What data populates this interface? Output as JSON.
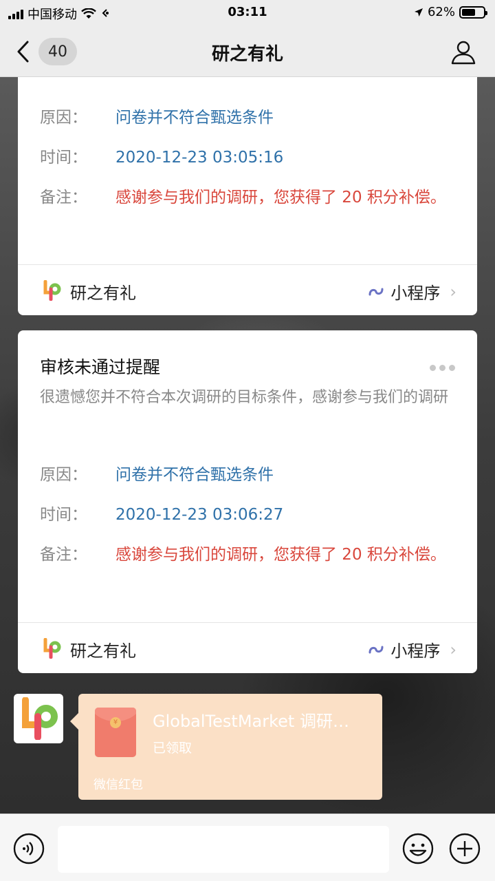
{
  "status_bar": {
    "carrier": "中国移动",
    "time": "03:11",
    "battery": "62%",
    "battery_level": 0.62
  },
  "nav": {
    "unread_count": "40",
    "title": "研之有礼",
    "back_icon": "chevron-left-icon",
    "profile_icon": "user-icon"
  },
  "cards": [
    {
      "reason_label": "原因：",
      "reason": "问卷并不符合甄选条件",
      "time_label": "时间：",
      "time": "2020-12-23 03:05:16",
      "note_label": "备注：",
      "note": "感谢参与我们的调研，您获得了 20 积分补偿。",
      "app_name": "研之有礼",
      "mini_program": "小程序"
    },
    {
      "title": "审核未通过提醒",
      "subtitle": "很遗憾您并不符合本次调研的目标条件，感谢参与我们的调研",
      "reason_label": "原因：",
      "reason": "问卷并不符合甄选条件",
      "time_label": "时间：",
      "time": "2020-12-23 03:06:27",
      "note_label": "备注：",
      "note": "感谢参与我们的调研，您获得了 20 积分补偿。",
      "app_name": "研之有礼",
      "mini_program": "小程序"
    }
  ],
  "red_packet": {
    "title": "GlobalTestMarket 调研…",
    "status": "已领取",
    "footer": "微信红包"
  },
  "input_bar": {
    "voice_icon": "voice-icon",
    "emoji_icon": "emoji-icon",
    "plus_icon": "plus-icon"
  },
  "colors": {
    "link_blue": "#2f71a9",
    "note_red": "#d9473c",
    "packet_bg": "#fbe0c6"
  }
}
